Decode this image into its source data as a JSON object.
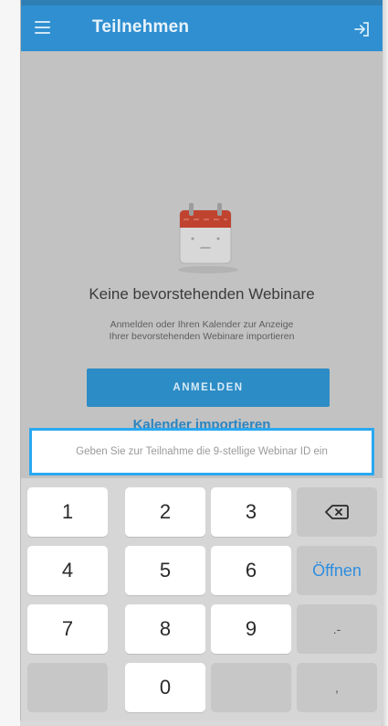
{
  "app": {
    "title": "Teilnehmen",
    "accent_color": "#2f8fd0",
    "menu_icon": "hamburger-menu-icon",
    "exit_icon": "exit-arrow-icon"
  },
  "empty_state": {
    "icon": "calendar-icon",
    "title": "Keine bevorstehenden Webinare",
    "description_line1": "Anmelden oder Ihren Kalender zur Anzeige",
    "description_line2": "Ihrer bevorstehenden Webinare importieren",
    "signin_label": "ANMELDEN",
    "import_label": "Kalender importieren"
  },
  "webinar_input": {
    "placeholder": "Geben Sie zur Teilnahme die 9-stellige Webinar ID ein",
    "value": "",
    "border_color": "#2aa8f0"
  },
  "keypad": {
    "keys": [
      "1",
      "2",
      "3",
      "4",
      "5",
      "6",
      "7",
      "8",
      "9",
      "0"
    ],
    "backspace_icon": "backspace-icon",
    "open_label": "Öffnen",
    "dot_dash": ".-",
    "comma": ","
  }
}
